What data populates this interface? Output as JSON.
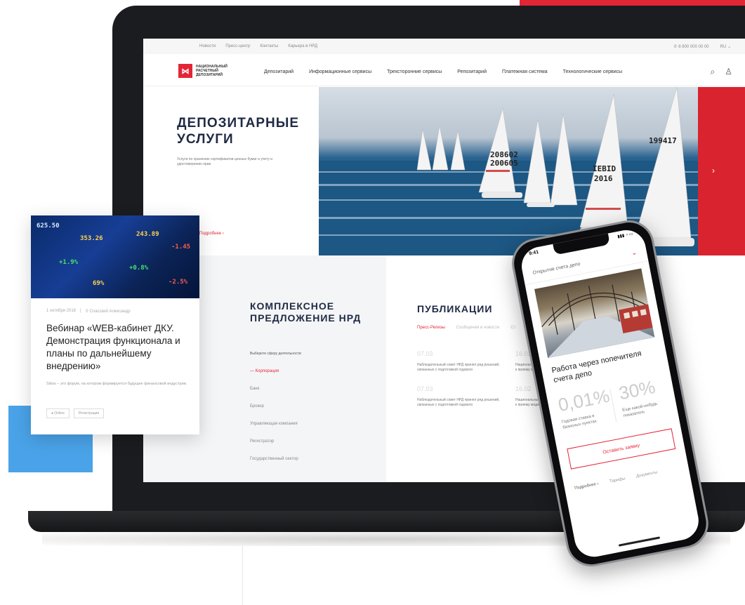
{
  "topbar": {
    "links": [
      "Новости",
      "Пресс-центр",
      "Контакты",
      "Карьера в НРД"
    ],
    "phone": "✆ 8 800 000 00 00",
    "lang": "RU ⌄"
  },
  "header": {
    "logo_mark": "⋈",
    "logo_text": "НАЦИОНАЛЬНЫЙ РАСЧЕТНЫЙ ДЕПОЗИТАРИЙ",
    "nav": [
      "Депозитарий",
      "Информационные сервисы",
      "Трехсторонние сервисы",
      "Репозитарий",
      "Платежная система",
      "Технологические сервисы"
    ],
    "search_icon": "⌕",
    "user_icon": "♙"
  },
  "hero": {
    "title": "ДЕПОЗИТАРНЫЕ УСЛУГИ",
    "subtitle": "Услуги по хранению сертификатов ценных бумаг и учету и удостоверению прав",
    "more": "Подробнее ›",
    "arrow": "›",
    "sail_numbers": [
      "208602",
      "200605",
      "199417",
      "IEBID",
      "2016"
    ]
  },
  "offer": {
    "title": "КОМПЛЕКСНОЕ ПРЕДЛОЖЕНИЕ НРД",
    "prompt": "Выберите сферу деятельности:",
    "items": [
      "— Корпорация",
      "Банк",
      "Брокер",
      "Управляющая компания",
      "Регистратор",
      "Государственный сектор"
    ]
  },
  "pubs": {
    "title": "ПУБЛИКАЦИИ",
    "tabs": [
      "Пресс-Релизы",
      "Сообщения и новости",
      "Ст"
    ],
    "items": [
      {
        "date": "07.03",
        "text": "Наблюдательный совет НРД принял ряд решений, связанных с подготовкой годового"
      },
      {
        "date": "16.02",
        "text": "Национальный расчетный депозитарий приступил к приему моделей"
      },
      {
        "date": "07.03",
        "text": "Наблюдательный совет НРД принял ряд решений, связанных с подготовкой годового"
      },
      {
        "date": "16.02",
        "text": "Национальный расчетный депозитарий приступил к приему моделей"
      }
    ]
  },
  "card": {
    "tickers": [
      "625.50",
      "353.26",
      "243.89",
      "-1.45",
      "+1.9%",
      "+0.8%",
      "69%",
      "-2.5%"
    ],
    "date": "1 октября 2018",
    "location": "⚲ Спасский Александр",
    "title": "Вебинар «WEB-кабинет ДКУ. Демонстрация функционала и планы по дальнейшему внедрению»",
    "desc": "Sibos – это форум, на котором формируется будущее финансовой индустрии.",
    "tags": [
      "● Online",
      "Регистрация"
    ]
  },
  "phone": {
    "time": "9:41",
    "status": "▮▮▮ ◔ ▭",
    "header": "Открытие счета депо",
    "chevron": "⌄",
    "title": "Работа через попечителя счета депо",
    "stat1": "0,01%",
    "stat1_label": "Годовая ставка в базисных пунктах",
    "stat2": "30%",
    "stat2_label": "Еще какой-нибудь показатель",
    "button": "Оставить заявку",
    "bottom": [
      "Подробнее ›",
      "Тарифы",
      "Документы"
    ]
  }
}
